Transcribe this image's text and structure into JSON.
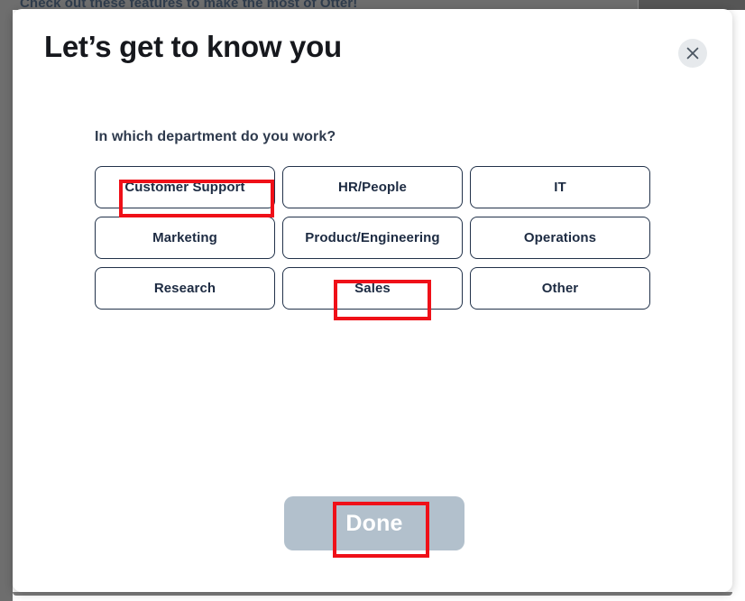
{
  "background": {
    "banner_text": "Check out these features to make the most of Otter!"
  },
  "modal": {
    "title": "Let’s get to know you",
    "close_label": "Close",
    "close_icon": "close-icon",
    "question": "In which department do you work?",
    "options": [
      {
        "label": "Customer Support",
        "selected": false
      },
      {
        "label": "HR/People",
        "selected": false
      },
      {
        "label": "IT",
        "selected": false
      },
      {
        "label": "Marketing",
        "selected": false
      },
      {
        "label": "Product/Engineering",
        "selected": false
      },
      {
        "label": "Operations",
        "selected": false
      },
      {
        "label": "Research",
        "selected": false
      },
      {
        "label": "Sales",
        "selected": false
      },
      {
        "label": "Other",
        "selected": false
      }
    ],
    "done_label": "Done",
    "done_enabled": false
  },
  "annotations": [
    {
      "target": "Customer Support",
      "color": "#ef1018"
    },
    {
      "target": "Sales",
      "color": "#ef1018"
    },
    {
      "target": "Done",
      "color": "#ef1018"
    }
  ],
  "colors": {
    "option_border": "#22324a",
    "option_text": "#1d2b42",
    "done_background": "#b2c0cc",
    "done_text": "#ffffff",
    "title_text": "#16181d",
    "annotation_red": "#ef1018",
    "overlay_gray": "#6e6e6e"
  }
}
